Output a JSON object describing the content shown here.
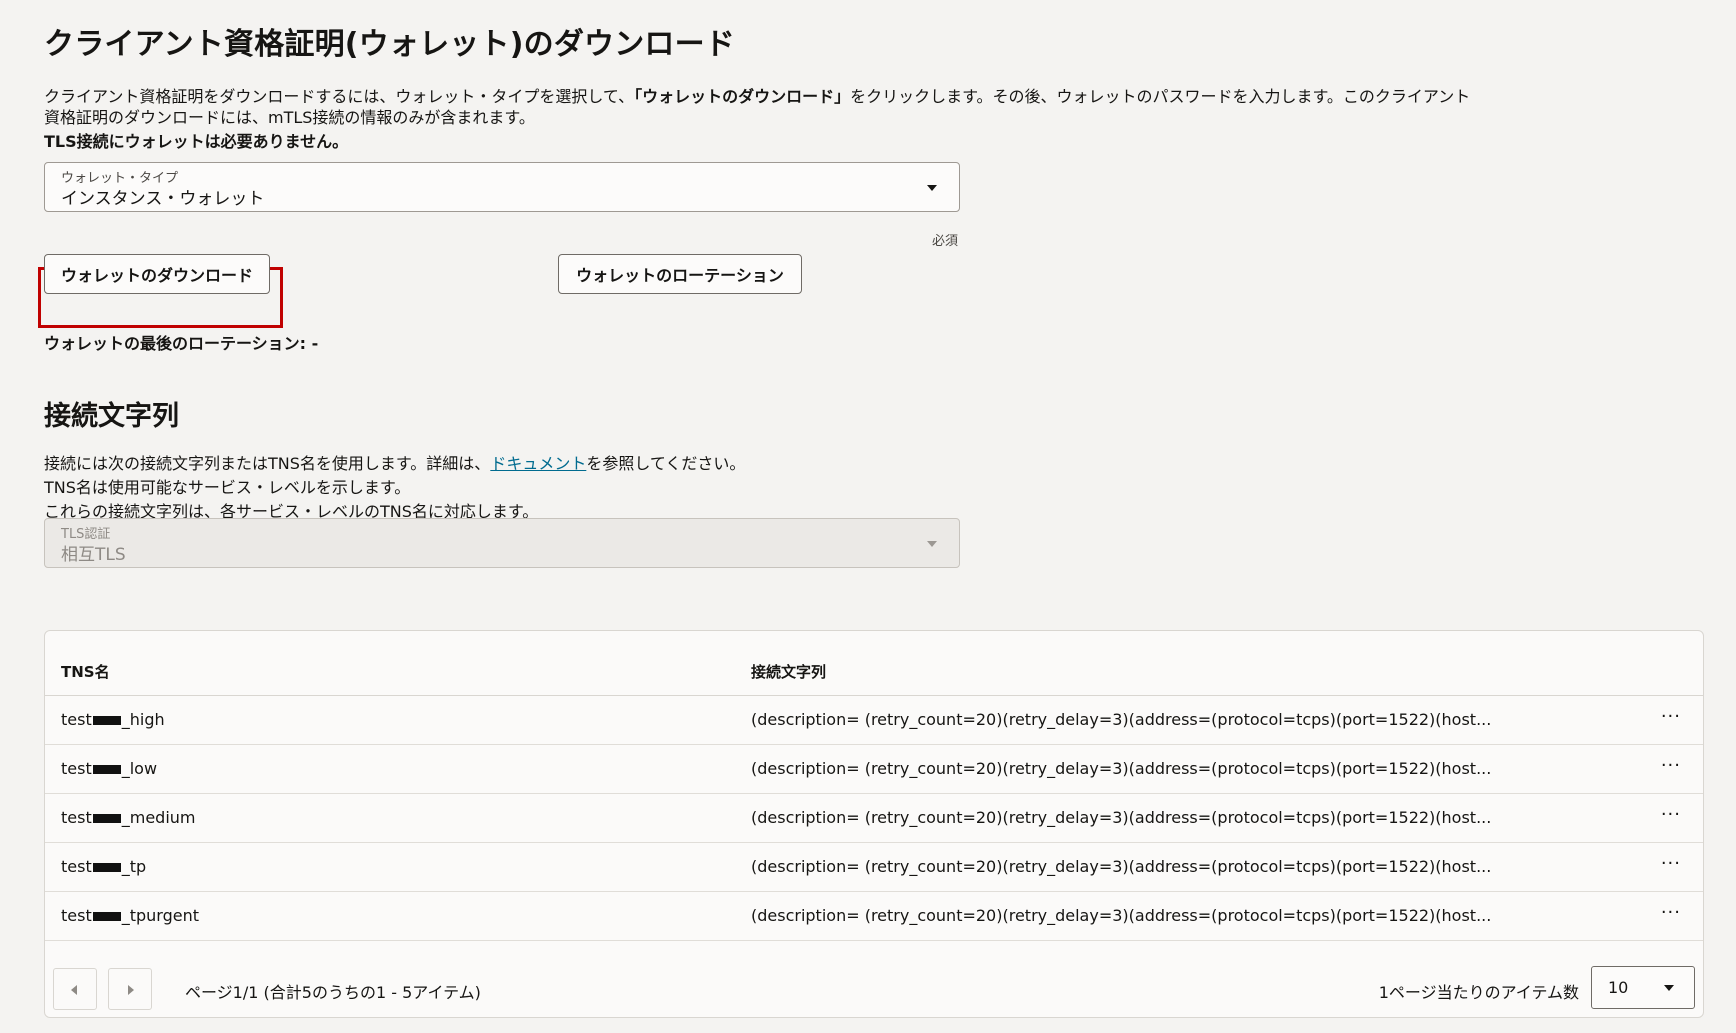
{
  "wallet_section": {
    "title": "クライアント資格証明(ウォレット)のダウンロード",
    "desc_part1": "クライアント資格証明をダウンロードするには、ウォレット・タイプを選択して、",
    "desc_bold": "「ウォレットのダウンロード」",
    "desc_part2": "をクリックします。その後、ウォレットのパスワードを入力します。このクライアント資格証明のダウンロードには、mTLS接続の情報のみが含まれます。",
    "tls_note": "TLS接続にウォレットは必要ありません。",
    "wallet_type_label": "ウォレット・タイプ",
    "wallet_type_value": "インスタンス・ウォレット",
    "required_label": "必須",
    "download_button": "ウォレットのダウンロード",
    "rotate_button": "ウォレットのローテーション",
    "last_rotation": "ウォレットの最後のローテーション: -"
  },
  "connection_section": {
    "title": "接続文字列",
    "line1_pre": "接続には次の接続文字列またはTNS名を使用します。詳細は、",
    "line1_link": "ドキュメント",
    "line1_post": "を参照してください。",
    "line2": "TNS名は使用可能なサービス・レベルを示します。",
    "line3": "これらの接続文字列は、各サービス・レベルのTNS名に対応します。",
    "tls_auth_label": "TLS認証",
    "tls_auth_value": "相互TLS"
  },
  "table": {
    "col_tns": "TNS名",
    "col_conn": "接続文字列",
    "rows": [
      {
        "prefix": "test",
        "suffix": "_high",
        "conn": "(description= (retry_count=20)(retry_delay=3)(address=(protocol=tcps)(port=1522)(host..."
      },
      {
        "prefix": "test",
        "suffix": "_low",
        "conn": "(description= (retry_count=20)(retry_delay=3)(address=(protocol=tcps)(port=1522)(host..."
      },
      {
        "prefix": "test",
        "suffix": "_medium",
        "conn": "(description= (retry_count=20)(retry_delay=3)(address=(protocol=tcps)(port=1522)(host..."
      },
      {
        "prefix": "test",
        "suffix": "_tp",
        "conn": "(description= (retry_count=20)(retry_delay=3)(address=(protocol=tcps)(port=1522)(host..."
      },
      {
        "prefix": "test",
        "suffix": "_tpurgent",
        "conn": "(description= (retry_count=20)(retry_delay=3)(address=(protocol=tcps)(port=1522)(host..."
      }
    ],
    "more_glyph": "···"
  },
  "pagination": {
    "page_info": "ページ1/1 (合計5のうちの1 - 5アイテム)",
    "items_per_page_label": "1ページ当たりのアイテム数",
    "items_per_page_value": "10"
  },
  "colors": {
    "highlight": "#c00000",
    "link": "#006b8f"
  }
}
